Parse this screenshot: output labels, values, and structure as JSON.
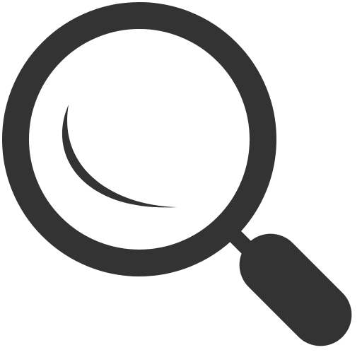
{
  "icon": {
    "name": "search-icon",
    "color": "#333333",
    "background": "#ffffff"
  }
}
